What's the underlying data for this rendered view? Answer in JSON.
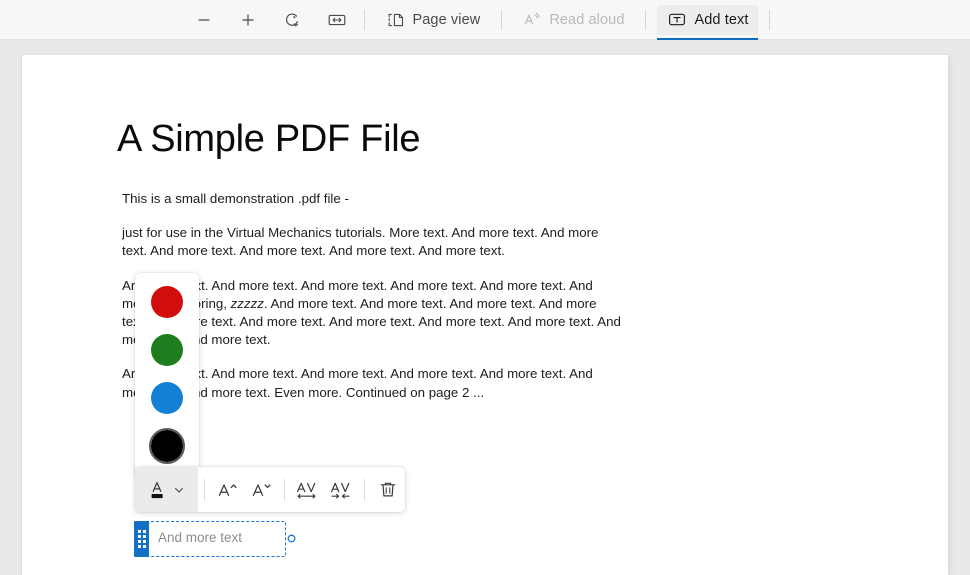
{
  "toolbar": {
    "zoom_out_label": "−",
    "zoom_in_label": "+",
    "rotate_icon": "rotate-icon",
    "fit_width_icon": "fit-to-width-icon",
    "page_view_label": "Page view",
    "read_aloud_label": "Read aloud",
    "add_text_label": "Add text",
    "active_accent_color": "#0f6cbd",
    "active_button": "Add text"
  },
  "document": {
    "title": "A Simple PDF File",
    "paragraphs": [
      "This is a small demonstration .pdf file -",
      "just for use in the Virtual Mechanics tutorials. More text. And more text. And more text. And more text. And more text. And more text. And more text.",
      "And more text. And more text. And more text. And more text. And more text. And more text. Boring, zzzzz. And more text. And more text. And more text. And more text. And more text. And more text. And more text. And more text. And more text. And more text. And more text.",
      "And more text. And more text. And more text. And more text. And more text. And more text. And more text. Even more. Continued on page 2 ..."
    ],
    "italic_word": "zzzzz"
  },
  "color_popup": {
    "swatches": [
      {
        "name": "red",
        "hex": "#D10D0D",
        "selected": false
      },
      {
        "name": "green",
        "hex": "#1E7D1E",
        "selected": false
      },
      {
        "name": "blue",
        "hex": "#1380D5",
        "selected": false
      },
      {
        "name": "black",
        "hex": "#000000",
        "selected": true
      }
    ]
  },
  "format_bar": {
    "font_color_label": "A",
    "font_color_swatch": "#111111",
    "chevron_icon": "chevron-down-icon",
    "grow_font_label": "A",
    "shrink_font_label": "A",
    "expand_spacing_label": "AV",
    "tighten_spacing_label": "AV",
    "delete_icon": "trash-icon"
  },
  "text_box": {
    "placeholder": "And more text",
    "accent_color": "#1271c4",
    "border_color": "#1976d2"
  }
}
